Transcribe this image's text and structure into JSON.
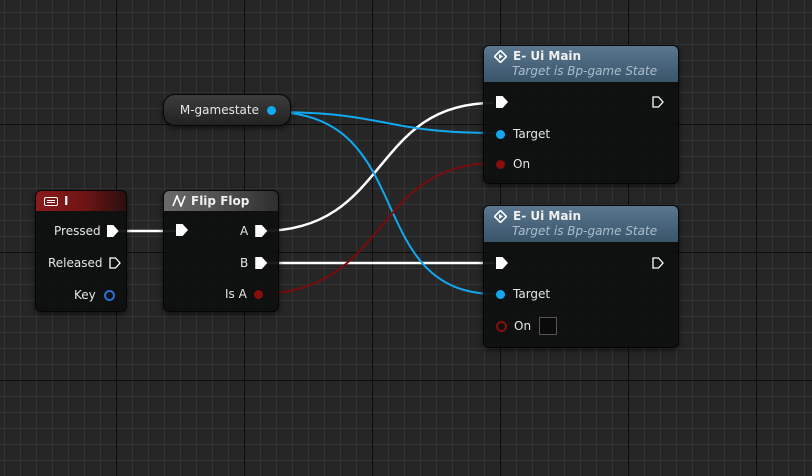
{
  "graph": {
    "variable_node": {
      "label": "M-gamestate"
    },
    "input_node": {
      "title": "I",
      "icon": "keyboard-icon",
      "pins": {
        "pressed": "Pressed",
        "released": "Released",
        "key": "Key"
      }
    },
    "flipflop_node": {
      "title": "Flip Flop",
      "icon": "flipflop-icon",
      "pins": {
        "a": "A",
        "b": "B",
        "is_a": "Is A"
      }
    },
    "function_nodes": [
      {
        "title": "E- Ui Main",
        "subtitle": "Target is Bp-game State",
        "target_label": "Target",
        "on_label": "On",
        "on_value": true
      },
      {
        "title": "E- Ui Main",
        "subtitle": "Target is Bp-game State",
        "target_label": "Target",
        "on_label": "On",
        "on_value": false
      }
    ]
  },
  "colors": {
    "exec_wire": "#ffffff",
    "object_wire": "#12a8f0",
    "bool_wire": "#7a0c0c",
    "input_header": "#8a1a1a",
    "function_header": "#4a6478"
  }
}
